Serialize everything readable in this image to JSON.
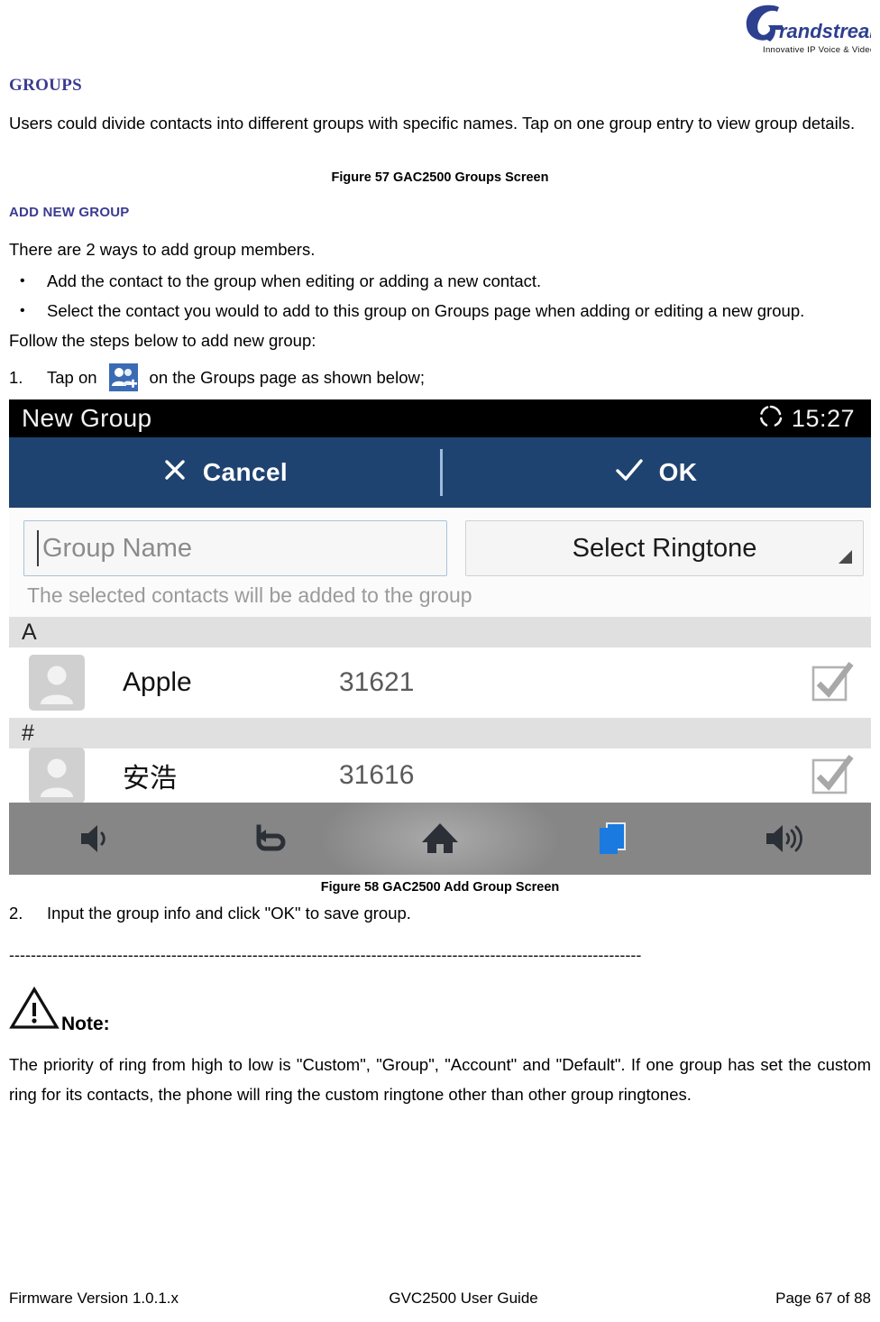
{
  "logo": {
    "wordmark": "randstream",
    "tagline": "Innovative IP Voice & Video",
    "color": "#2d3f8f"
  },
  "document": {
    "section_heading": "GROUPS",
    "intro_paragraph": "Users could divide contacts into different groups with specific names. Tap on one group entry to view group details.",
    "figure_57_caption": "Figure 57 GAC2500 Groups Screen",
    "sub_heading": "ADD NEW GROUP",
    "ways_intro": "There are 2 ways to add group members.",
    "bullets": [
      "Add the contact to the group when editing or adding a new contact.",
      "Select the contact you would to add to this group on Groups page when adding or editing a new group."
    ],
    "follow_steps": "Follow the steps below to add new group:",
    "step1_number": "1.",
    "step1_before_icon": "Tap on",
    "step1_after_icon": "on the Groups page as shown below;",
    "figure_58_caption": "Figure 58 GAC2500 Add Group Screen",
    "step2_number": "2.",
    "step2_text": "Input the group info and click \"OK\" to save group.",
    "dashed_rule": "---------------------------------------------------------------------------------------------------------------------",
    "note_label": "Note:",
    "note_paragraph": "The priority of ring from high to low is \"Custom\", \"Group\", \"Account\" and \"Default\". If one group has set the custom ring for its contacts, the phone will ring the custom ringtone other than other group ringtones.",
    "heading_color": "#3b3b91"
  },
  "device_screenshot": {
    "statusbar": {
      "title": "New Group",
      "sync_icon": "sync-circle-icon",
      "clock": "15:27",
      "background": "#000000"
    },
    "actionbar": {
      "background": "#1f4371",
      "cancel_icon": "close-x-icon",
      "cancel_label": "Cancel",
      "ok_icon": "check-icon",
      "ok_label": "OK"
    },
    "form": {
      "group_name_placeholder": "Group Name",
      "group_name_value": "",
      "ringtone_label": "Select Ringtone",
      "ringtone_arrow_icon": "corner-triangle-icon",
      "hint": "The selected contacts will be added to the group"
    },
    "contacts": [
      {
        "section": "A",
        "avatar_icon": "person-avatar-icon",
        "name": "Apple",
        "number": "31621",
        "checked": true,
        "check_icon": "checkbox-checked-icon"
      },
      {
        "section": "#",
        "avatar_icon": "person-avatar-icon",
        "name": "安浩",
        "number": "31616",
        "checked": true,
        "check_icon": "checkbox-checked-icon"
      }
    ],
    "navbar": {
      "background": "#868686",
      "buttons": [
        {
          "name": "volume-down-icon",
          "label": "Volume Down"
        },
        {
          "name": "back-icon",
          "label": "Back"
        },
        {
          "name": "home-icon",
          "label": "Home"
        },
        {
          "name": "recent-apps-icon",
          "label": "Recent Apps",
          "color": "#1b7ae0"
        },
        {
          "name": "volume-up-icon",
          "label": "Volume Up"
        }
      ]
    }
  },
  "footer": {
    "firmware": "Firmware Version 1.0.1.x",
    "guide": "GVC2500 User Guide",
    "page": "Page 67 of 88"
  }
}
